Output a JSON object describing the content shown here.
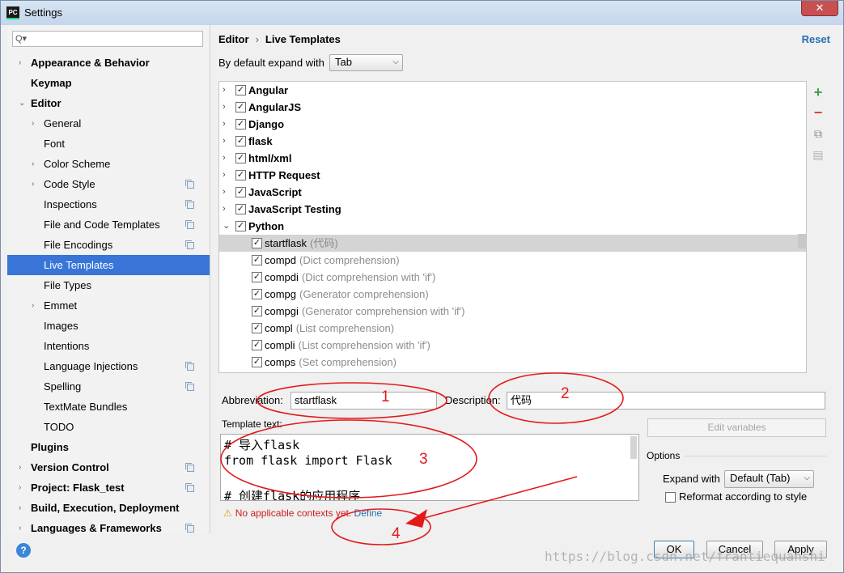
{
  "window": {
    "title": "Settings",
    "app_icon": "PC",
    "close_glyph": "✕"
  },
  "search": {
    "placeholder": "",
    "icon_glyph": "Q▾"
  },
  "sidebar": {
    "items": [
      {
        "label": "Appearance & Behavior",
        "level": 0,
        "arrow": "›",
        "bold": true,
        "copy": false,
        "selected": false
      },
      {
        "label": "Keymap",
        "level": 0,
        "arrow": "",
        "bold": true,
        "copy": false,
        "selected": false
      },
      {
        "label": "Editor",
        "level": 0,
        "arrow": "⌄",
        "bold": true,
        "copy": false,
        "selected": false
      },
      {
        "label": "General",
        "level": 1,
        "arrow": "›",
        "bold": false,
        "copy": false,
        "selected": false
      },
      {
        "label": "Font",
        "level": 1,
        "arrow": "",
        "bold": false,
        "copy": false,
        "selected": false
      },
      {
        "label": "Color Scheme",
        "level": 1,
        "arrow": "›",
        "bold": false,
        "copy": false,
        "selected": false
      },
      {
        "label": "Code Style",
        "level": 1,
        "arrow": "›",
        "bold": false,
        "copy": true,
        "selected": false
      },
      {
        "label": "Inspections",
        "level": 1,
        "arrow": "",
        "bold": false,
        "copy": true,
        "selected": false
      },
      {
        "label": "File and Code Templates",
        "level": 1,
        "arrow": "",
        "bold": false,
        "copy": true,
        "selected": false
      },
      {
        "label": "File Encodings",
        "level": 1,
        "arrow": "",
        "bold": false,
        "copy": true,
        "selected": false
      },
      {
        "label": "Live Templates",
        "level": 1,
        "arrow": "",
        "bold": false,
        "copy": false,
        "selected": true
      },
      {
        "label": "File Types",
        "level": 1,
        "arrow": "",
        "bold": false,
        "copy": false,
        "selected": false
      },
      {
        "label": "Emmet",
        "level": 1,
        "arrow": "›",
        "bold": false,
        "copy": false,
        "selected": false
      },
      {
        "label": "Images",
        "level": 1,
        "arrow": "",
        "bold": false,
        "copy": false,
        "selected": false
      },
      {
        "label": "Intentions",
        "level": 1,
        "arrow": "",
        "bold": false,
        "copy": false,
        "selected": false
      },
      {
        "label": "Language Injections",
        "level": 1,
        "arrow": "",
        "bold": false,
        "copy": true,
        "selected": false
      },
      {
        "label": "Spelling",
        "level": 1,
        "arrow": "",
        "bold": false,
        "copy": true,
        "selected": false
      },
      {
        "label": "TextMate Bundles",
        "level": 1,
        "arrow": "",
        "bold": false,
        "copy": false,
        "selected": false
      },
      {
        "label": "TODO",
        "level": 1,
        "arrow": "",
        "bold": false,
        "copy": false,
        "selected": false
      },
      {
        "label": "Plugins",
        "level": 0,
        "arrow": "",
        "bold": true,
        "copy": false,
        "selected": false
      },
      {
        "label": "Version Control",
        "level": 0,
        "arrow": "›",
        "bold": true,
        "copy": true,
        "selected": false
      },
      {
        "label": "Project: Flask_test",
        "level": 0,
        "arrow": "›",
        "bold": true,
        "copy": true,
        "selected": false
      },
      {
        "label": "Build, Execution, Deployment",
        "level": 0,
        "arrow": "›",
        "bold": true,
        "copy": false,
        "selected": false
      },
      {
        "label": "Languages & Frameworks",
        "level": 0,
        "arrow": "›",
        "bold": true,
        "copy": true,
        "selected": false
      }
    ]
  },
  "header": {
    "crumb_1": "Editor",
    "crumb_sep": "›",
    "crumb_2": "Live Templates",
    "reset": "Reset"
  },
  "expand_default": {
    "label": "By default expand with",
    "value": "Tab"
  },
  "templates": [
    {
      "kind": "group",
      "name": "Angular",
      "desc": "",
      "expanded": false,
      "checked": true,
      "selected": false
    },
    {
      "kind": "group",
      "name": "AngularJS",
      "desc": "",
      "expanded": false,
      "checked": true,
      "selected": false
    },
    {
      "kind": "group",
      "name": "Django",
      "desc": "",
      "expanded": false,
      "checked": true,
      "selected": false
    },
    {
      "kind": "group",
      "name": "flask",
      "desc": "",
      "expanded": false,
      "checked": true,
      "selected": false
    },
    {
      "kind": "group",
      "name": "html/xml",
      "desc": "",
      "expanded": false,
      "checked": true,
      "selected": false
    },
    {
      "kind": "group",
      "name": "HTTP Request",
      "desc": "",
      "expanded": false,
      "checked": true,
      "selected": false
    },
    {
      "kind": "group",
      "name": "JavaScript",
      "desc": "",
      "expanded": false,
      "checked": true,
      "selected": false
    },
    {
      "kind": "group",
      "name": "JavaScript Testing",
      "desc": "",
      "expanded": false,
      "checked": true,
      "selected": false
    },
    {
      "kind": "group",
      "name": "Python",
      "desc": "",
      "expanded": true,
      "checked": true,
      "selected": false
    },
    {
      "kind": "item",
      "name": "startflask",
      "desc": "(代码)",
      "checked": true,
      "selected": true
    },
    {
      "kind": "item",
      "name": "compd",
      "desc": "(Dict comprehension)",
      "checked": true,
      "selected": false
    },
    {
      "kind": "item",
      "name": "compdi",
      "desc": "(Dict comprehension with 'if')",
      "checked": true,
      "selected": false
    },
    {
      "kind": "item",
      "name": "compg",
      "desc": "(Generator comprehension)",
      "checked": true,
      "selected": false
    },
    {
      "kind": "item",
      "name": "compgi",
      "desc": "(Generator comprehension with 'if')",
      "checked": true,
      "selected": false
    },
    {
      "kind": "item",
      "name": "compl",
      "desc": "(List comprehension)",
      "checked": true,
      "selected": false
    },
    {
      "kind": "item",
      "name": "compli",
      "desc": "(List comprehension with 'if')",
      "checked": true,
      "selected": false
    },
    {
      "kind": "item",
      "name": "comps",
      "desc": "(Set comprehension)",
      "checked": true,
      "selected": false
    }
  ],
  "tools": {
    "add": "+",
    "remove": "−",
    "copy_glyph": "⧉",
    "text_glyph": "▤"
  },
  "editor": {
    "abbreviation_label": "Abbreviation:",
    "abbreviation_value": "startflask",
    "description_label": "Description:",
    "description_value": "代码",
    "template_text_label": "Template text:",
    "template_lines": [
      "# 导入flask",
      "from flask import Flask",
      "",
      "# 创建flask的应用程序"
    ],
    "edit_variables": "Edit variables",
    "options_label": "Options",
    "expand_with_label": "Expand with",
    "expand_with_value": "Default (Tab)",
    "reformat_label": "Reformat according to style",
    "warning_icon": "⚠",
    "warning_text": "No applicable contexts yet.",
    "define_link": "Define"
  },
  "buttons": {
    "ok": "OK",
    "cancel": "Cancel",
    "apply": "Apply",
    "help": "?"
  },
  "watermark": "https://blog.csdn.net/frantiequanshi",
  "annotations": {
    "n1": "1",
    "n2": "2",
    "n3": "3",
    "n4": "4",
    "color": "#e31a1a"
  },
  "colors": {
    "accent": "#3875d7",
    "link": "#2470b3",
    "error": "#cc1f1f",
    "add_green": "#3ca34a",
    "remove_red": "#d0453a"
  }
}
